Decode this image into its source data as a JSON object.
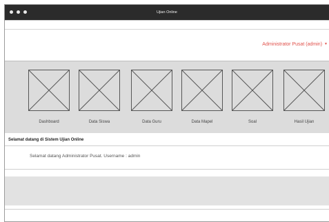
{
  "window": {
    "title": "Ujian Online"
  },
  "header": {
    "user_menu_label": "Administrator Pusat (admin)",
    "user_menu_caret": "chevron-down-icon"
  },
  "nav": {
    "items": [
      {
        "label": "Dashboard",
        "icon": "image-placeholder-icon"
      },
      {
        "label": "Data Siswa",
        "icon": "image-placeholder-icon"
      },
      {
        "label": "Data Guru",
        "icon": "image-placeholder-icon"
      },
      {
        "label": "Data Mapel",
        "icon": "image-placeholder-icon"
      },
      {
        "label": "Soal",
        "icon": "image-placeholder-icon"
      },
      {
        "label": "Hasil Ujian",
        "icon": "image-placeholder-icon"
      }
    ]
  },
  "welcome": {
    "title": "Selamat datang di Sistem Ujian Online",
    "message": "Selamat datang Administrator Pusat. Username : admin"
  },
  "colors": {
    "titlebar": "#2b2b2b",
    "accent": "#e0504a",
    "nav_background": "#dcdcdc",
    "footer_background": "#e2e2e2"
  }
}
